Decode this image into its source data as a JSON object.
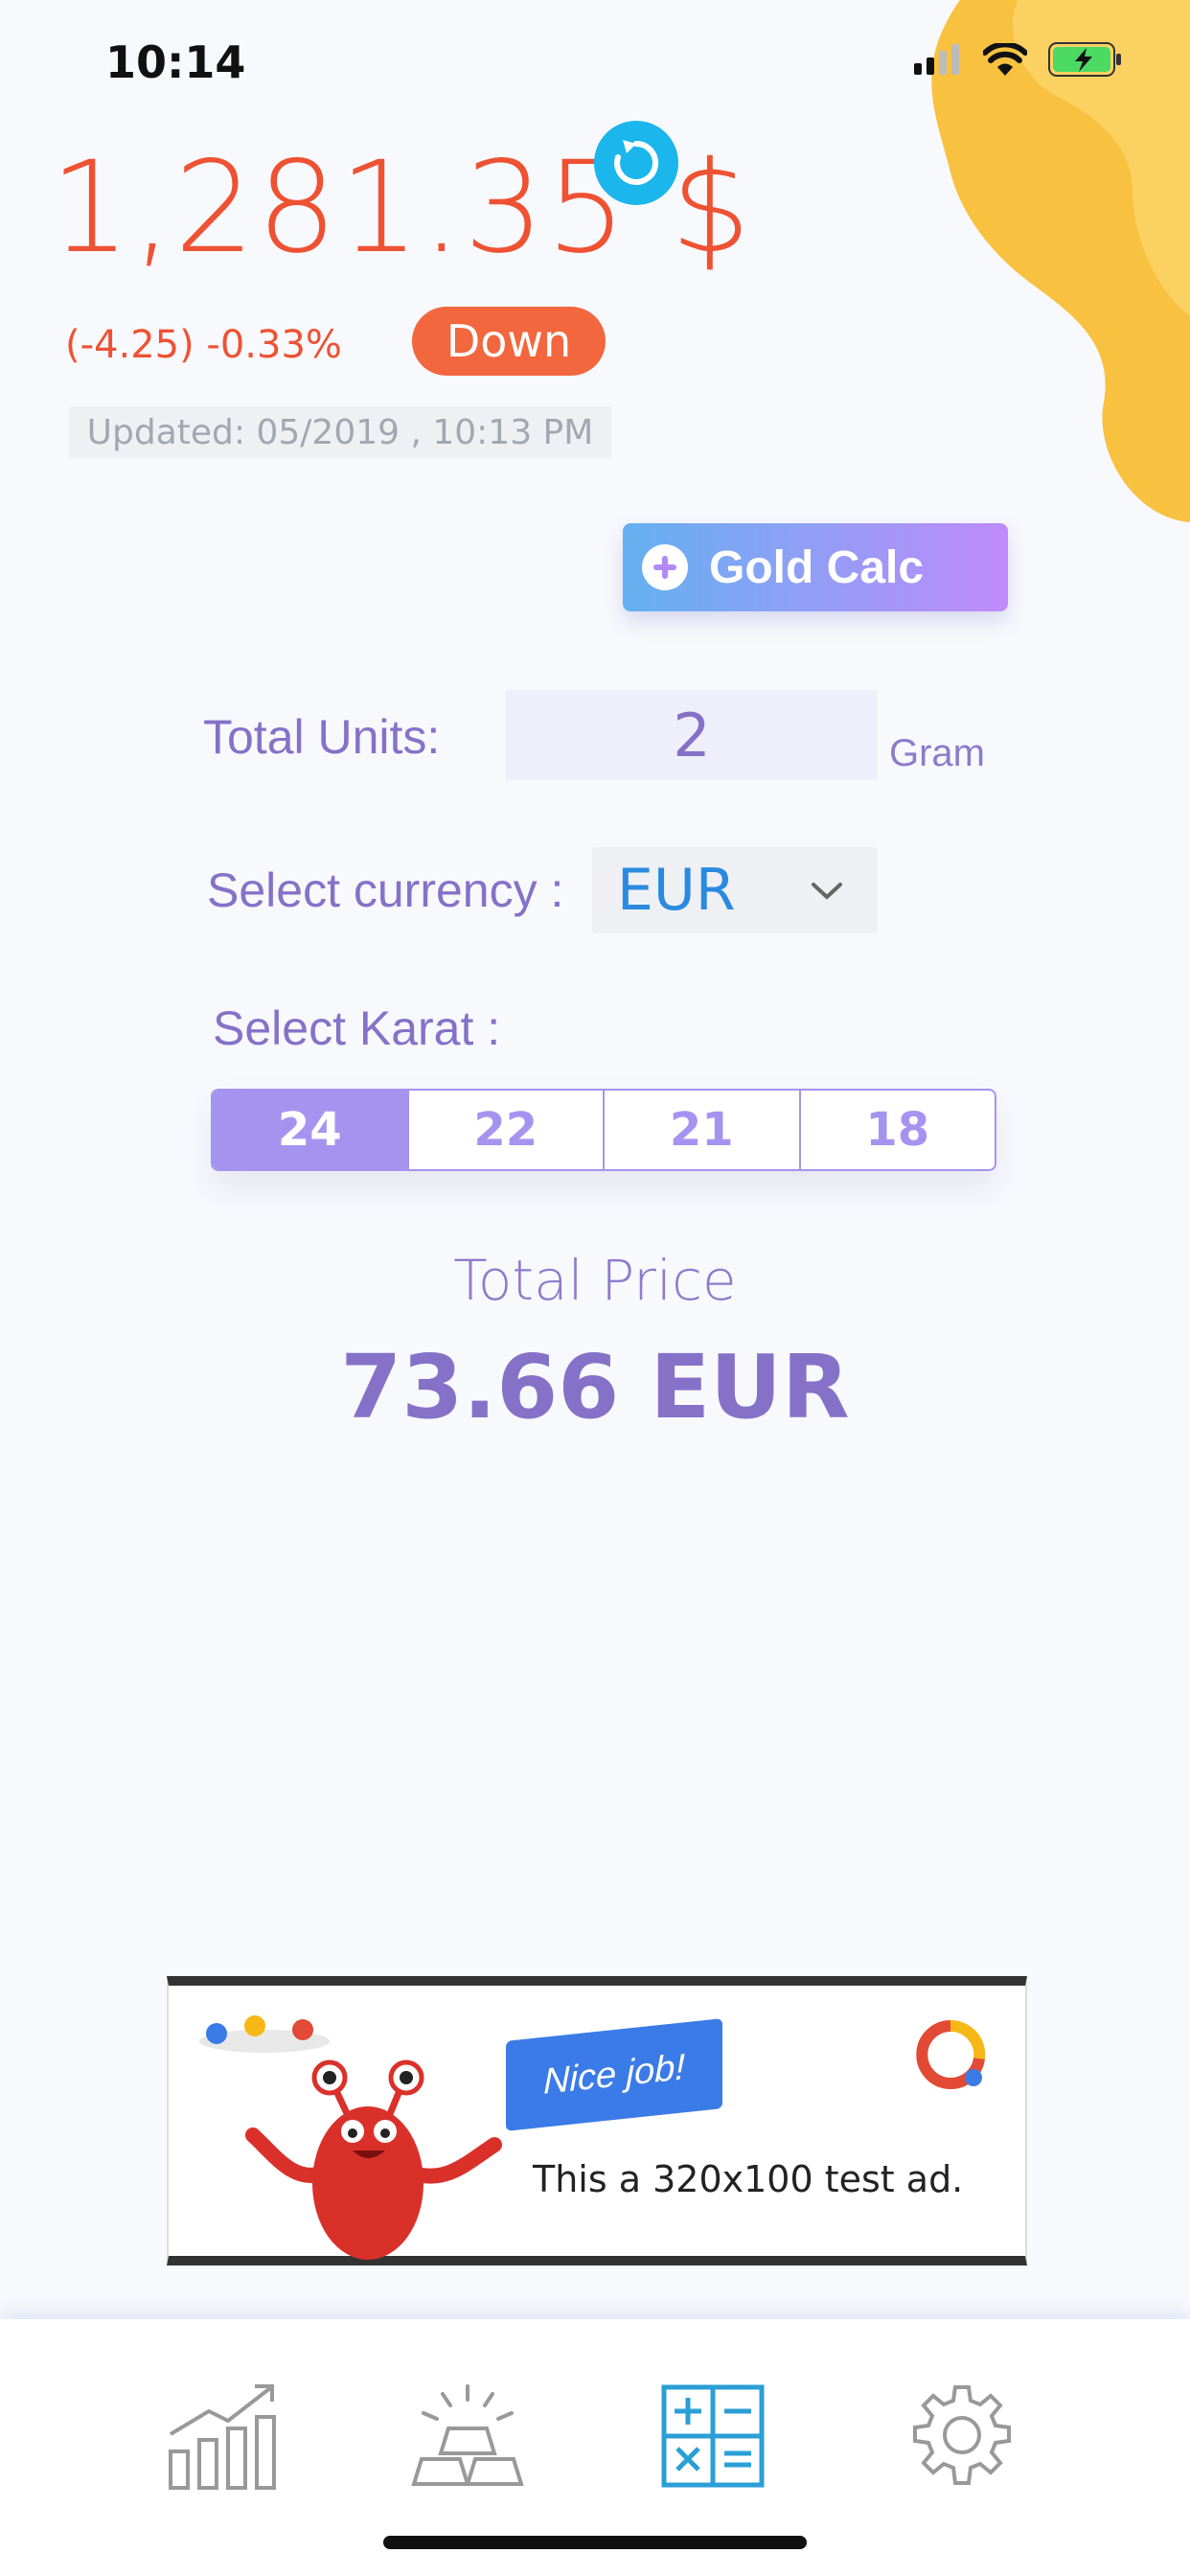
{
  "status_bar": {
    "time": "10:14"
  },
  "quote": {
    "price": "1,281.35 $",
    "change": "(-4.25) -0.33%",
    "trend_badge": "Down",
    "updated": "Updated: 05/2019 , 10:13 PM"
  },
  "calculator": {
    "button_label": "Gold Calc",
    "units_label": "Total Units:",
    "units_value": "2",
    "unit_name": "Gram",
    "currency_label": "Select currency :",
    "currency_value": "EUR",
    "karat_label": "Select Karat :",
    "karats": [
      "24",
      "22",
      "21",
      "18"
    ],
    "selected_karat": "24",
    "total_label": "Total Price",
    "total_value": "73.66 EUR"
  },
  "ad": {
    "headline": "Nice job!",
    "text": "This a 320x100 test ad."
  },
  "tabs": [
    {
      "icon": "chart-icon"
    },
    {
      "icon": "gold-bars-icon"
    },
    {
      "icon": "calculator-icon"
    },
    {
      "icon": "settings-icon"
    }
  ],
  "colors": {
    "price_red": "#ee5233",
    "accent_purple": "#8572c8",
    "karat_purple": "#a594ef",
    "refresh_blue": "#1ab6ec",
    "blob_yellow": "#f9c443"
  }
}
